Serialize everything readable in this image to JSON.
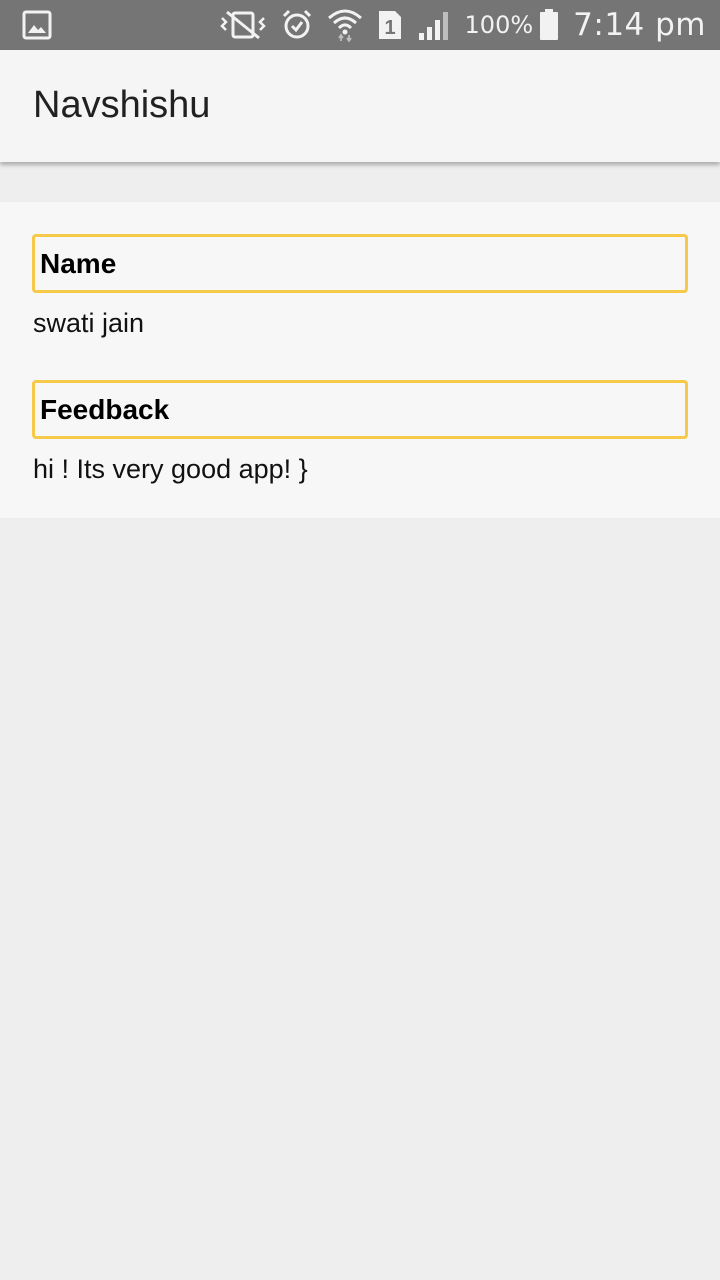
{
  "status_bar": {
    "icons": [
      "image-notification-icon",
      "vibrate-icon",
      "alarm-icon",
      "wifi-icon",
      "sim-1-icon",
      "signal-icon",
      "battery-icon"
    ],
    "sim_label": "1",
    "battery_percent": "100%",
    "time": "7:14 pm"
  },
  "app_bar": {
    "title": "Navshishu"
  },
  "form": {
    "name_label": "Name",
    "name_value": "swati jain",
    "feedback_label": "Feedback",
    "feedback_value": "hi ! Its very good app! }"
  },
  "colors": {
    "status_bar_bg": "#757575",
    "app_bar_bg": "#f5f5f5",
    "page_bg": "#eeeeee",
    "card_bg": "#f8f7f8",
    "label_border": "#f7c948"
  }
}
